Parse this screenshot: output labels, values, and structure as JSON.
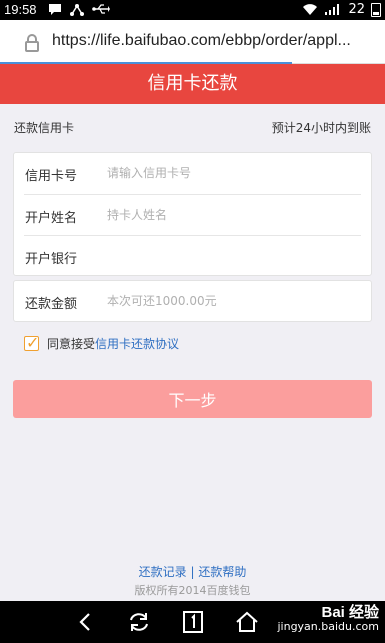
{
  "status": {
    "time": "19:58",
    "battery": "22"
  },
  "browser": {
    "url": "https://life.baifubao.com/ebbp/order/appl..."
  },
  "header": {
    "title": "信用卡还款"
  },
  "info": {
    "left": "还款信用卡",
    "right": "预计24小时内到账"
  },
  "form": {
    "card_number": {
      "label": "信用卡号",
      "placeholder": "请输入信用卡号"
    },
    "holder_name": {
      "label": "开户姓名",
      "placeholder": "持卡人姓名"
    },
    "bank": {
      "label": "开户银行",
      "placeholder": ""
    },
    "amount": {
      "label": "还款金额",
      "placeholder": "本次可还1000.00元"
    }
  },
  "agreement": {
    "prefix": "同意接受",
    "link": "信用卡还款协议",
    "checked": true
  },
  "next_button": "下一步",
  "footer": {
    "link1": "还款记录",
    "separator": "|",
    "link2": "还款帮助",
    "copyright": "版权所有2014百度钱包"
  },
  "watermark": {
    "brand": "Bai 经验",
    "site": "jingyan.baidu.com"
  },
  "colors": {
    "header": "#e8463f",
    "button": "#fb9e9d",
    "link": "#2f6fc2",
    "checkbox": "#f0a030"
  }
}
